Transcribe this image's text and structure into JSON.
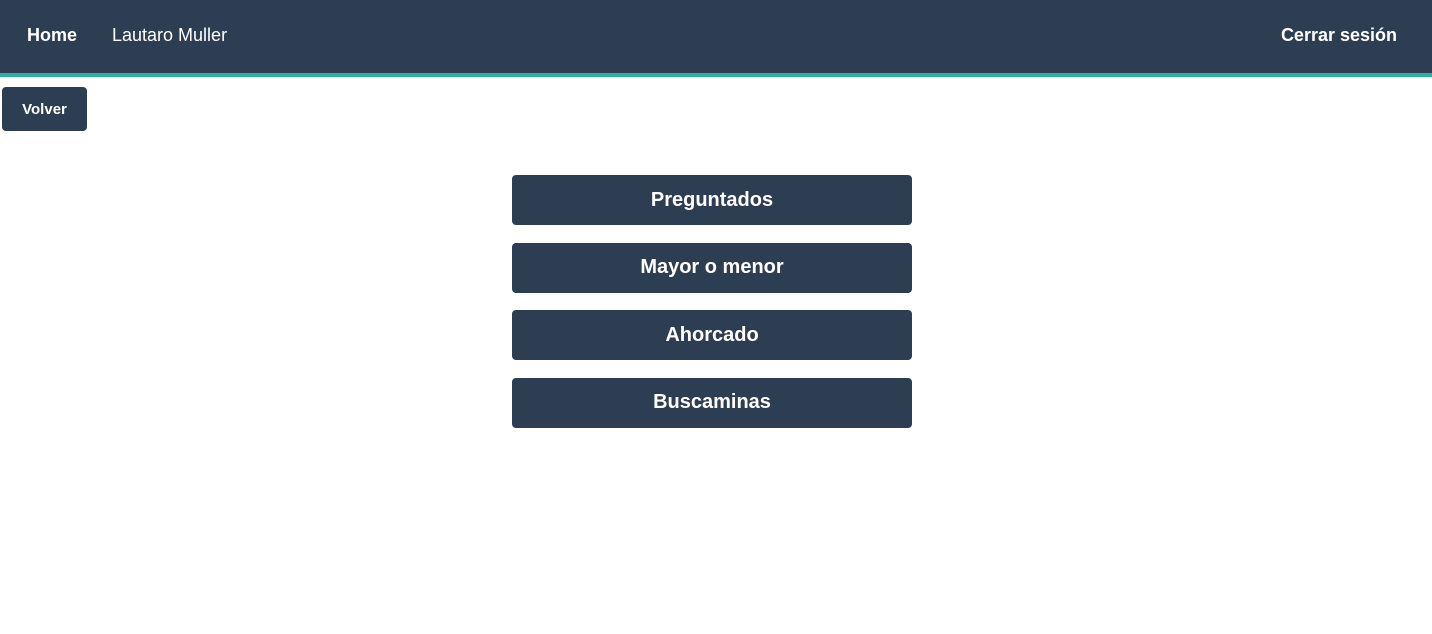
{
  "nav": {
    "home_label": "Home",
    "user_name": "Lautaro Muller",
    "logout_label": "Cerrar sesión"
  },
  "back_label": "Volver",
  "games": [
    {
      "label": "Preguntados"
    },
    {
      "label": "Mayor o menor"
    },
    {
      "label": "Ahorcado"
    },
    {
      "label": "Buscaminas"
    }
  ],
  "colors": {
    "primary": "#2e3e52",
    "accent": "#2ab39a",
    "text_on_primary": "#ffffff",
    "background": "#ffffff"
  }
}
